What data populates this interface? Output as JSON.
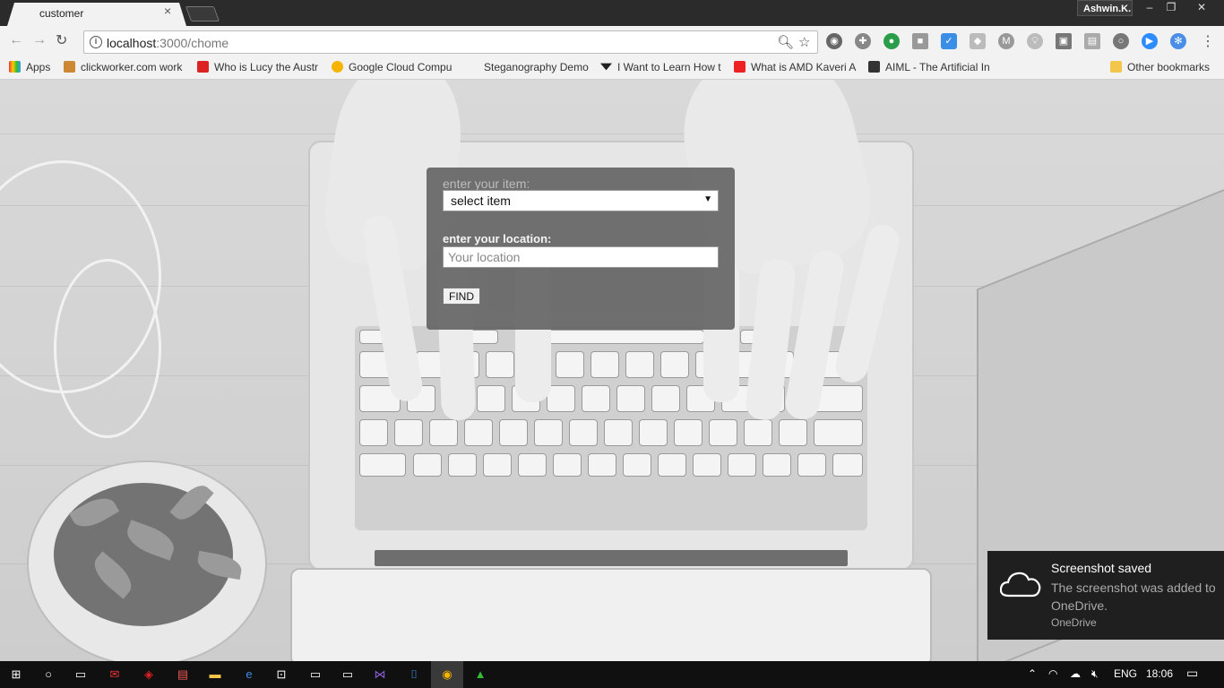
{
  "browser": {
    "tab_title": "customer",
    "tab_close": "×",
    "profile_name": "Ashwin.K.",
    "window_controls": [
      "–",
      "❐",
      "✕"
    ],
    "url_host": "localhost",
    "url_path": ":3000/chome"
  },
  "bookmarks": [
    {
      "label": "Apps",
      "icon": "apps-grid-icon",
      "color": "#e0a000"
    },
    {
      "label": "clickworker.com work",
      "icon": "clickworker-icon",
      "color": "#c83"
    },
    {
      "label": "Who is Lucy the Austr",
      "icon": "shield-icon",
      "color": "#d22"
    },
    {
      "label": "Google Cloud Compu",
      "icon": "google-cloud-icon",
      "color": "#f4b400"
    },
    {
      "label": "Steganography Demo",
      "icon": "blank-page-icon",
      "color": "#f2f2f2"
    },
    {
      "label": "I Want to Learn How t",
      "icon": "chevron-logo-icon",
      "color": "#222"
    },
    {
      "label": "What is AMD Kaveri A",
      "icon": "youtube-icon",
      "color": "#e22"
    },
    {
      "label": "AIML - The Artificial In",
      "icon": "aiml-icon",
      "color": "#333"
    },
    {
      "label": "Other bookmarks",
      "icon": "folder-icon",
      "color": "#f3c54a"
    }
  ],
  "form": {
    "item_label": "enter your item:",
    "item_select_value": "select item",
    "location_label": "enter your location:",
    "location_placeholder": "Your location",
    "find_label": "FIND"
  },
  "toast": {
    "title": "Screenshot saved",
    "body": "The screenshot was added to OneDrive.",
    "app": "OneDrive"
  },
  "taskbar": {
    "language": "ENG",
    "time": "18:06"
  },
  "colors": {
    "form_panel": "#5f5f5f",
    "toast_bg": "#1f1f1f",
    "taskbar_bg": "#101010"
  }
}
